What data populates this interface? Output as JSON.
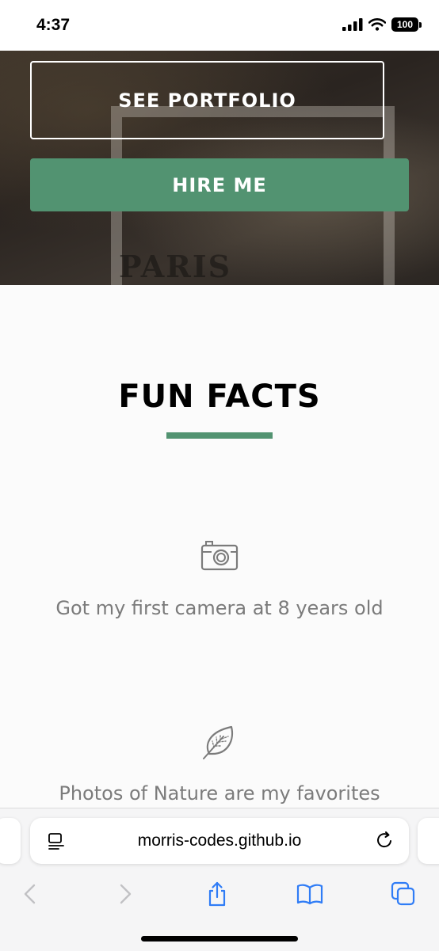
{
  "status_bar": {
    "time": "4:37",
    "battery": "100"
  },
  "hero": {
    "background_text": "PARIS",
    "portfolio_button": "SEE PORTFOLIO",
    "hire_button": "HIRE ME"
  },
  "fun_facts": {
    "title": "FUN FACTS",
    "items": [
      {
        "icon": "camera-icon",
        "text": "Got my first camera at 8 years old"
      },
      {
        "icon": "leaf-icon",
        "text": "Photos of Nature are my favorites"
      }
    ]
  },
  "browser": {
    "url": "morris-codes.github.io",
    "toolbar": [
      "back-icon",
      "forward-icon",
      "share-icon",
      "bookmarks-icon",
      "tabs-icon"
    ]
  },
  "colors": {
    "accent": "#529371",
    "fact_text": "#7b7b7b",
    "browser_blue": "#2f7cf6"
  }
}
